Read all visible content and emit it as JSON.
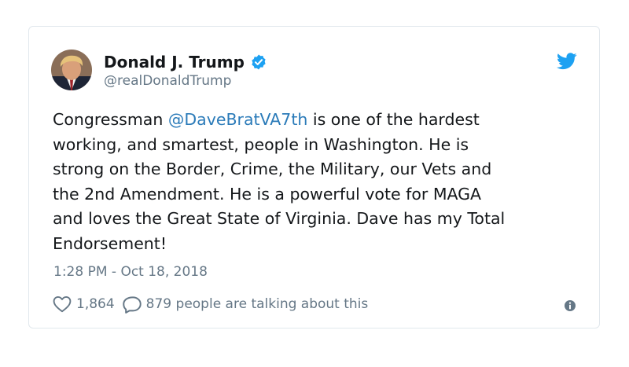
{
  "tweet": {
    "author_name": "Donald J. Trump",
    "author_handle": "@realDonaldTrump",
    "text_lines": [
      {
        "before": "Congressman ",
        "mention": "@DaveBratVA7th",
        "after": " is one of the hardest"
      },
      {
        "before": "working, and smartest, people in Washington. He is",
        "mention": "",
        "after": ""
      },
      {
        "before": "strong on the Border, Crime, the Military, our Vets and",
        "mention": "",
        "after": ""
      },
      {
        "before": "the 2nd Amendment. He is a powerful vote for MAGA",
        "mention": "",
        "after": ""
      },
      {
        "before": "and loves the Great State of Virginia. Dave has my Total",
        "mention": "",
        "after": ""
      },
      {
        "before": "Endorsement!",
        "mention": "",
        "after": ""
      }
    ],
    "timestamp": "1:28 PM - Oct 18, 2018",
    "like_count": "1,864",
    "talking_text": "879 people are talking about this"
  },
  "icons": {
    "verified": "verified-badge-icon",
    "brand": "twitter-bird-icon",
    "like": "heart-icon",
    "reply": "speech-bubble-icon",
    "info": "info-icon"
  },
  "colors": {
    "brand_blue": "#1da1f2",
    "mention_blue": "#2b7bb9",
    "secondary_text": "#657786",
    "border": "#e1e8ed"
  }
}
